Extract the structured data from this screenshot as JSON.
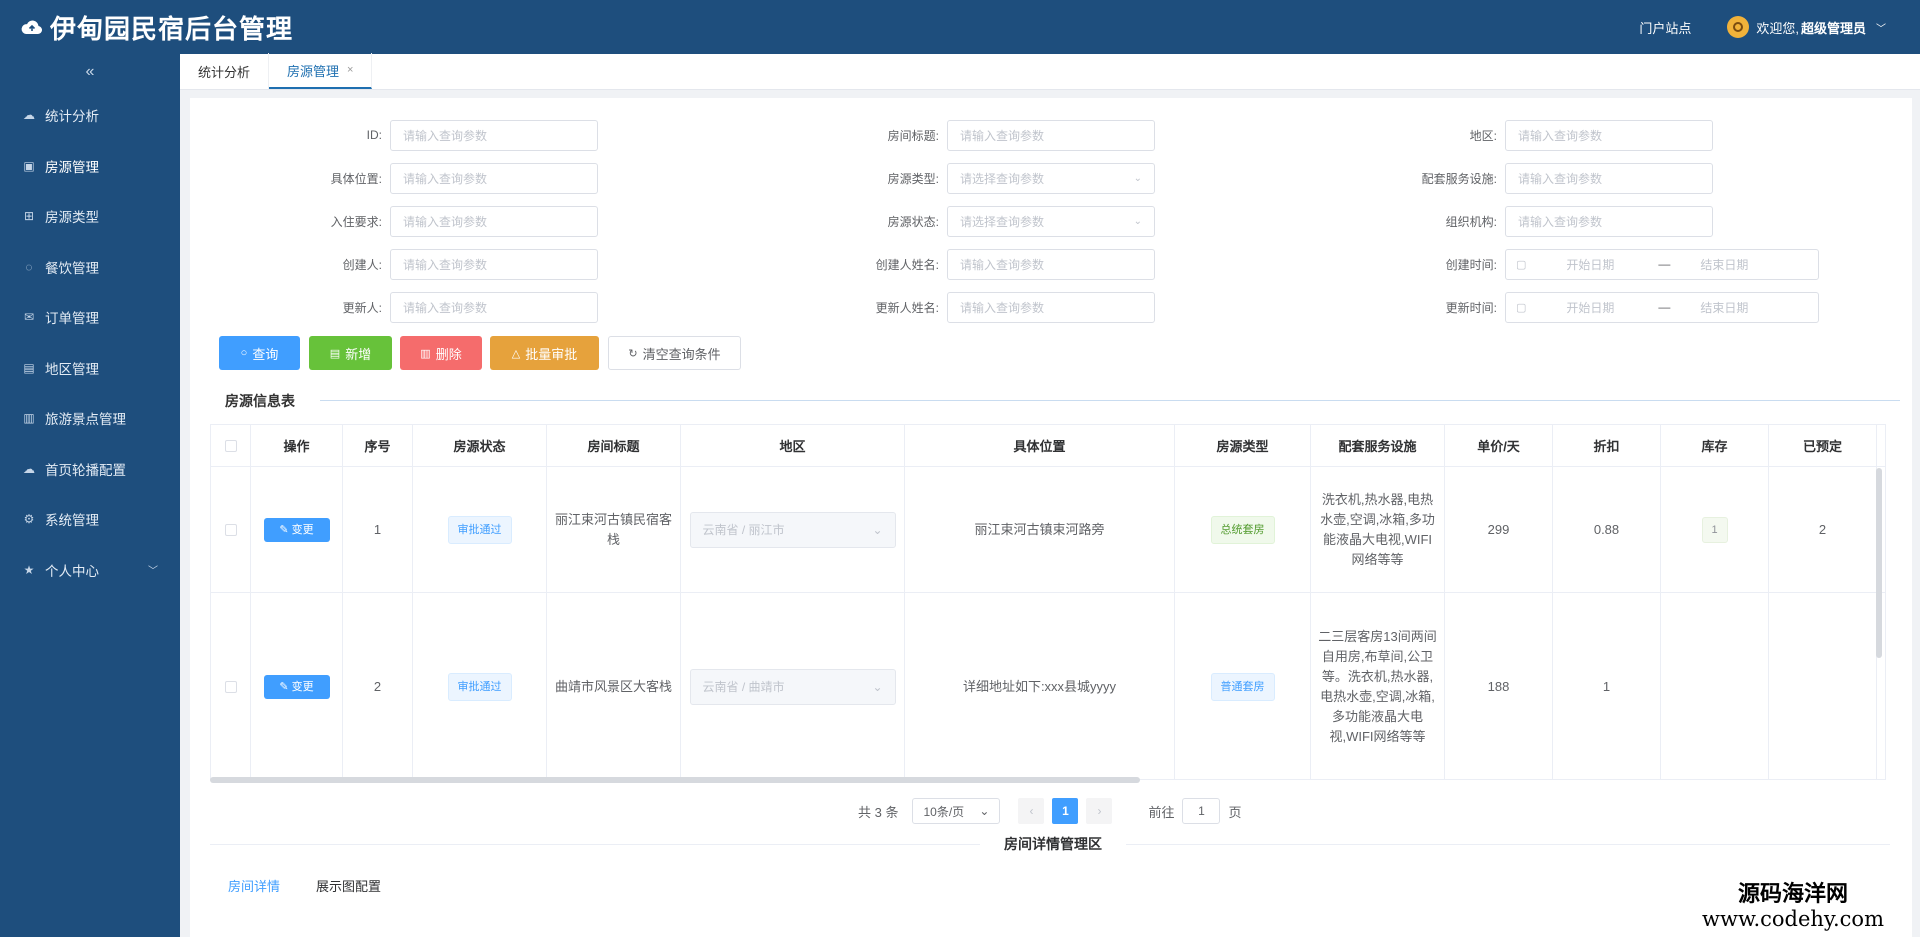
{
  "app": {
    "title": "伊甸园民宿后台管理",
    "portal_link": "门户站点",
    "welcome": "欢迎您,",
    "user_role": "超级管理员"
  },
  "sidebar": {
    "collapse_icon": "«",
    "items": [
      {
        "label": "统计分析",
        "icon": "cloud-icon"
      },
      {
        "label": "房源管理",
        "icon": "image-icon"
      },
      {
        "label": "房源类型",
        "icon": "cart-icon"
      },
      {
        "label": "餐饮管理",
        "icon": "chat-icon"
      },
      {
        "label": "订单管理",
        "icon": "mail-icon"
      },
      {
        "label": "地区管理",
        "icon": "document-icon"
      },
      {
        "label": "旅游景点管理",
        "icon": "files-icon"
      },
      {
        "label": "首页轮播配置",
        "icon": "cloud-upload-icon"
      },
      {
        "label": "系统管理",
        "icon": "gear-icon"
      },
      {
        "label": "个人中心",
        "icon": "star-icon"
      }
    ]
  },
  "tabs": [
    {
      "label": "统计分析"
    },
    {
      "label": "房源管理",
      "close": "×"
    }
  ],
  "filters": {
    "placeholder_input": "请输入查询参数",
    "placeholder_select": "请选择查询参数",
    "id_label": "ID:",
    "room_title_label": "房间标题:",
    "region_label": "地区:",
    "location_label": "具体位置:",
    "room_type_label": "房源类型:",
    "facilities_label": "配套服务设施:",
    "checkin_label": "入住要求:",
    "status_label": "房源状态:",
    "org_label": "组织机构:",
    "creator_label": "创建人:",
    "creator_name_label": "创建人姓名:",
    "create_time_label": "创建时间:",
    "updater_label": "更新人:",
    "updater_name_label": "更新人姓名:",
    "update_time_label": "更新时间:",
    "start_date": "开始日期",
    "end_date": "结束日期",
    "date_sep": "—"
  },
  "buttons": {
    "query": "查询",
    "add": "新增",
    "delete": "删除",
    "batch_approve": "批量审批",
    "clear": "清空查询条件"
  },
  "table": {
    "title": "房源信息表",
    "columns": [
      "操作",
      "序号",
      "房源状态",
      "房间标题",
      "地区",
      "具体位置",
      "房源类型",
      "配套服务设施",
      "单价/天",
      "折扣",
      "库存",
      "已预定"
    ],
    "edit_label": "变更",
    "rows": [
      {
        "index": "1",
        "status": "审批通过",
        "title": "丽江束河古镇民宿客栈",
        "region": "云南省 / 丽江市",
        "location": "丽江束河古镇束河路旁",
        "type": "总统套房",
        "facilities": "洗衣机,热水器,电热水壶,空调,冰箱,多功能液晶大电视,WIFI网络等等",
        "price": "299",
        "discount": "0.88",
        "stock": "1",
        "booked": "2"
      },
      {
        "index": "2",
        "status": "审批通过",
        "title": "曲靖市风景区大客栈",
        "region": "云南省 / 曲靖市",
        "location": "详细地址如下:xxx县城yyyy",
        "type": "普通套房",
        "facilities": "二三层客房13间两间自用房,布草间,公卫等。洗衣机,热水器,电热水壶,空调,冰箱,多功能液晶大电视,WIFI网络等等",
        "price": "188",
        "discount": "1",
        "stock": "",
        "booked": ""
      }
    ]
  },
  "pagination": {
    "total": "共 3 条",
    "page_size": "10条/页",
    "prev": "‹",
    "current": "1",
    "next": "›",
    "goto_prefix": "前往",
    "goto_value": "1",
    "goto_suffix": "页"
  },
  "detail": {
    "title": "房间详情管理区",
    "tabs": [
      "房间详情",
      "展示图配置"
    ]
  },
  "watermark": {
    "line1": "源码海洋网",
    "line2": "www.codehy.com"
  },
  "colors": {
    "header_bg": "#1e4e7d",
    "primary": "#409eff",
    "success": "#67c23a",
    "danger": "#f56c6c",
    "warning": "#e6a23c"
  }
}
